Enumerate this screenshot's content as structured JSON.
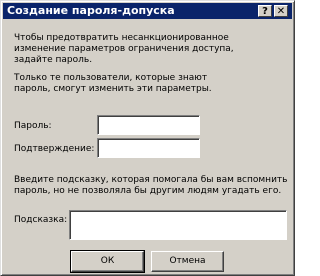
{
  "window": {
    "title": "Создание пароля-допуска",
    "help_label": "?",
    "close_label": "✕"
  },
  "intro": {
    "line1": "Чтобы предотвратить несанкционированное",
    "line2": "изменение параметров ограничения доступа,",
    "line3": "задайте пароль.",
    "line4": "Только те пользователи, которые знают",
    "line5": "пароль, смогут изменить эти параметры."
  },
  "form": {
    "password_label": "Пароль:",
    "password_value": "",
    "confirm_label": "Подтверждение:",
    "confirm_value": ""
  },
  "hint_info": {
    "line1": "Введите подсказку, которая помогала бы вам вспомнить",
    "line2": "пароль, но не позволяла бы другим людям угадать его."
  },
  "hint": {
    "label": "Подсказка:",
    "value": ""
  },
  "buttons": {
    "ok": "ОК",
    "cancel": "Отмена"
  }
}
